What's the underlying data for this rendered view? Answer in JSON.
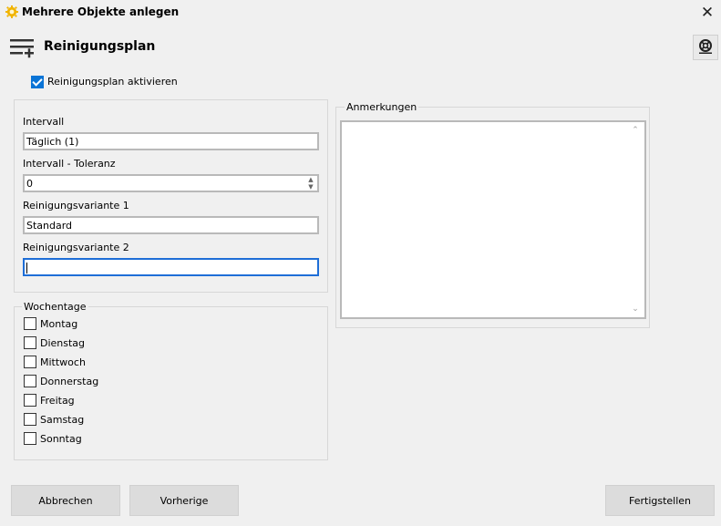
{
  "window": {
    "title": "Mehrere Objekte anlegen",
    "close_symbol": "✕"
  },
  "header": {
    "title": "Reinigungsplan"
  },
  "activate_checkbox": {
    "label": "Reinigungsplan aktivieren",
    "checked": true
  },
  "settings": {
    "interval_label": "Intervall",
    "interval_value": "Täglich (1)",
    "tolerance_label": "Intervall - Toleranz",
    "tolerance_value": "0",
    "variant1_label": "Reinigungsvariante 1",
    "variant1_value": "Standard",
    "variant2_label": "Reinigungsvariante 2",
    "variant2_value": ""
  },
  "weekdays": {
    "legend": "Wochentage",
    "days": [
      {
        "label": "Montag",
        "checked": false
      },
      {
        "label": "Dienstag",
        "checked": false
      },
      {
        "label": "Mittwoch",
        "checked": false
      },
      {
        "label": "Donnerstag",
        "checked": false
      },
      {
        "label": "Freitag",
        "checked": false
      },
      {
        "label": "Samstag",
        "checked": false
      },
      {
        "label": "Sonntag",
        "checked": false
      }
    ]
  },
  "notes": {
    "legend": "Anmerkungen",
    "value": ""
  },
  "buttons": {
    "cancel": "Abbrechen",
    "previous": "Vorherige",
    "finish": "Fertigstellen"
  },
  "colors": {
    "accent": "#0a74d6",
    "focus_border": "#1e6ed7",
    "background": "#f0f0f0"
  }
}
